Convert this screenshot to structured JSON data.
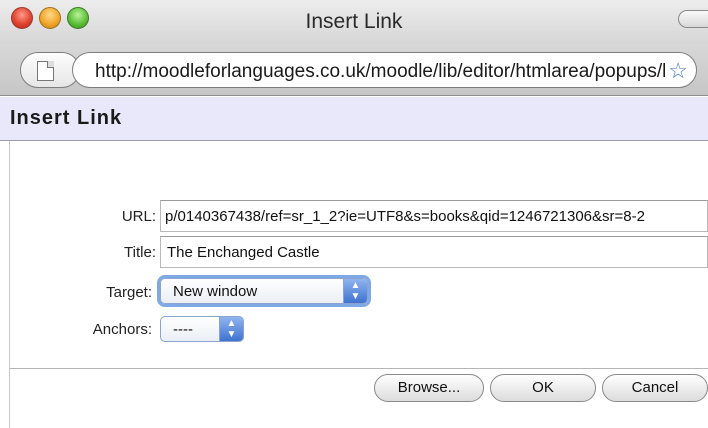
{
  "window": {
    "title": "Insert Link"
  },
  "browser": {
    "url": "http://moodleforlanguages.co.uk/moodle/lib/editor/htmlarea/popups/link.php"
  },
  "dialog": {
    "title": "Insert Link",
    "fields": {
      "url": {
        "label": "URL:",
        "value": "p/0140367438/ref=sr_1_2?ie=UTF8&s=books&qid=1246721306&sr=8-2"
      },
      "title": {
        "label": "Title:",
        "value": "The Enchanged Castle"
      },
      "target": {
        "label": "Target:",
        "value": "New window"
      },
      "anchors": {
        "label": "Anchors:",
        "value": "----"
      }
    },
    "buttons": {
      "browse": "Browse...",
      "ok": "OK",
      "cancel": "Cancel"
    }
  },
  "icons": {
    "page": "page-icon",
    "bookmark": "star-icon",
    "select_arrows": "updown-arrows-icon"
  }
}
